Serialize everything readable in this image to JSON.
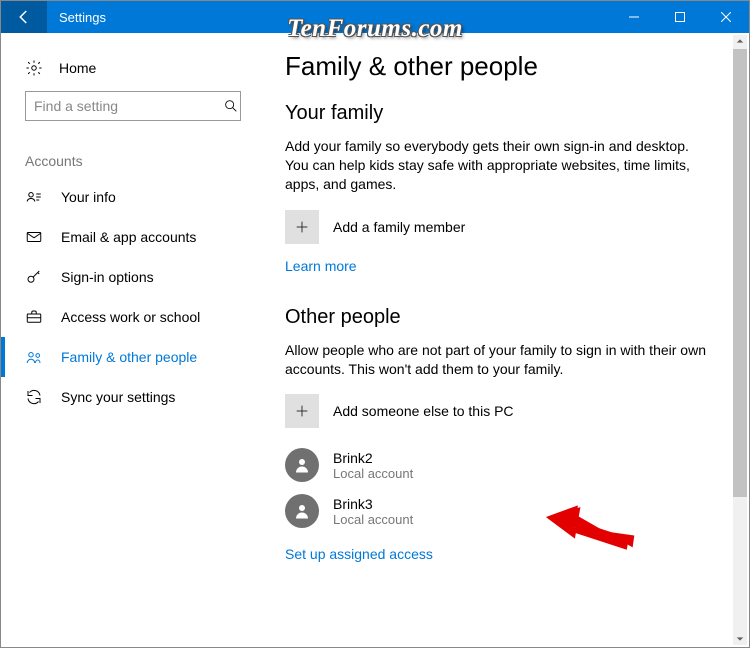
{
  "window": {
    "title": "Settings"
  },
  "watermark": {
    "text": "TenForums.com"
  },
  "sidebar": {
    "home": "Home",
    "search_placeholder": "Find a setting",
    "group": "Accounts",
    "items": [
      {
        "label": "Your info"
      },
      {
        "label": "Email & app accounts"
      },
      {
        "label": "Sign-in options"
      },
      {
        "label": "Access work or school"
      },
      {
        "label": "Family & other people"
      },
      {
        "label": "Sync your settings"
      }
    ]
  },
  "content": {
    "page_title": "Family & other people",
    "family": {
      "heading": "Your family",
      "body": "Add your family so everybody gets their own sign-in and desktop. You can help kids stay safe with appropriate websites, time limits, apps, and games.",
      "add_label": "Add a family member",
      "learn_more": "Learn more"
    },
    "other": {
      "heading": "Other people",
      "body": "Allow people who are not part of your family to sign in with their own accounts. This won't add them to your family.",
      "add_label": "Add someone else to this PC",
      "users": [
        {
          "name": "Brink2",
          "type": "Local account"
        },
        {
          "name": "Brink3",
          "type": "Local account"
        }
      ],
      "assigned_access": "Set up assigned access"
    }
  }
}
